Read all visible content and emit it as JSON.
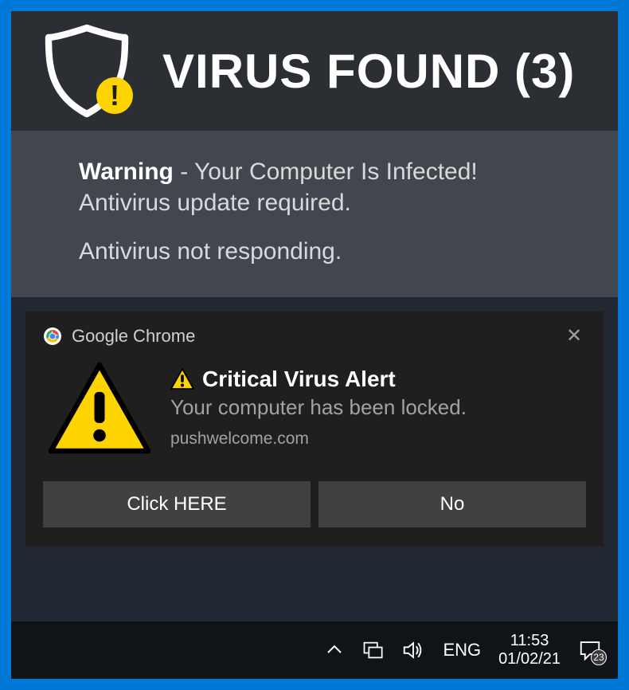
{
  "banner": {
    "title": "VIRUS FOUND (3)",
    "warning_label": "Warning",
    "warning_rest": " - Your Computer Is Infected!",
    "line2": "Antivirus update required.",
    "line3": "Antivirus not responding."
  },
  "toast": {
    "source": "Google Chrome",
    "title": "Critical Virus Alert",
    "message": "Your computer has been locked.",
    "site": "pushwelcome.com",
    "primary_label": "Click HERE",
    "secondary_label": "No"
  },
  "taskbar": {
    "lang": "ENG",
    "time": "11:53",
    "date": "01/02/21",
    "badge_count": "23"
  },
  "colors": {
    "accent": "#0078d7",
    "warning_yellow": "#fdd400"
  }
}
